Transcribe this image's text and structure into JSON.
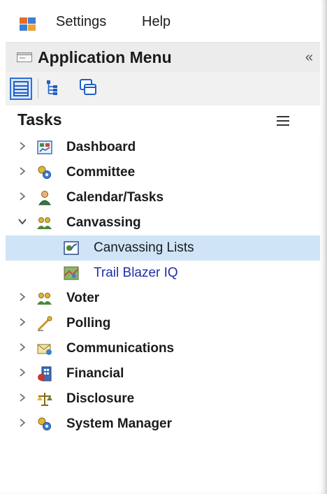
{
  "menubar": {
    "settings_label": "Settings",
    "help_label": "Help"
  },
  "app_menu": {
    "title": "Application Menu",
    "collapse_glyph": "«"
  },
  "toolbar": {
    "buttons": [
      "list-view-icon",
      "tree-view-icon",
      "windows-icon"
    ],
    "active": "list-view-icon"
  },
  "tasks": {
    "title": "Tasks"
  },
  "tree": {
    "items": [
      {
        "label": "Dashboard",
        "icon": "dashboard-icon"
      },
      {
        "label": "Committee",
        "icon": "committee-icon"
      },
      {
        "label": "Calendar/Tasks",
        "icon": "calendar-tasks-icon"
      },
      {
        "label": "Canvassing",
        "icon": "canvassing-icon",
        "expanded": true,
        "children": [
          {
            "label": "Canvassing Lists",
            "icon": "canvassing-lists-icon",
            "selected": true
          },
          {
            "label": "Trail Blazer IQ",
            "icon": "trail-blazer-icon"
          }
        ]
      },
      {
        "label": "Voter",
        "icon": "voter-icon"
      },
      {
        "label": "Polling",
        "icon": "polling-icon"
      },
      {
        "label": "Communications",
        "icon": "communications-icon"
      },
      {
        "label": "Financial",
        "icon": "financial-icon"
      },
      {
        "label": "Disclosure",
        "icon": "disclosure-icon"
      },
      {
        "label": "System Manager",
        "icon": "system-manager-icon"
      }
    ]
  },
  "colors": {
    "selection": "#cfe4f7",
    "link_text": "#1f2fa6",
    "active_button_border": "#2f6fd6"
  }
}
